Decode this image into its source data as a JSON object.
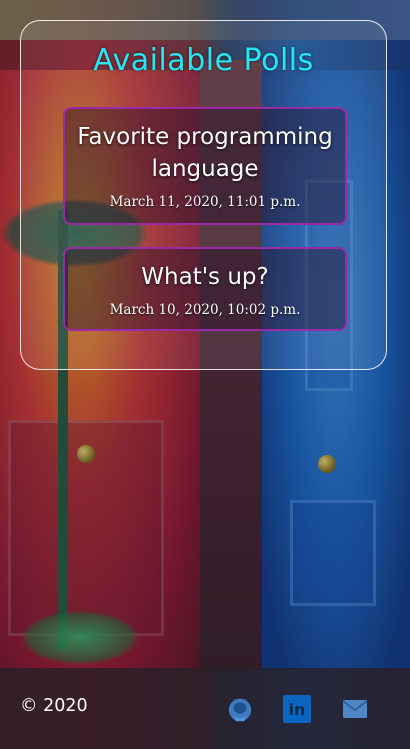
{
  "polls": {
    "title": "Available Polls",
    "items": [
      {
        "question": "Favorite programming language",
        "date": "March 11, 2020, 11:01 p.m."
      },
      {
        "question": "What's up?",
        "date": "March 10, 2020, 10:02 p.m."
      }
    ]
  },
  "footer": {
    "copyright": "© 2020",
    "icons": [
      "github-icon",
      "linkedin-icon",
      "mail-icon"
    ],
    "linkedin_glyph": "in"
  },
  "colors": {
    "title": "#23e8f6",
    "card_border": "#9a2aa8",
    "linkedin": "#0a66c2",
    "mail": "#4f86c6",
    "github": "#3d7bc4"
  }
}
